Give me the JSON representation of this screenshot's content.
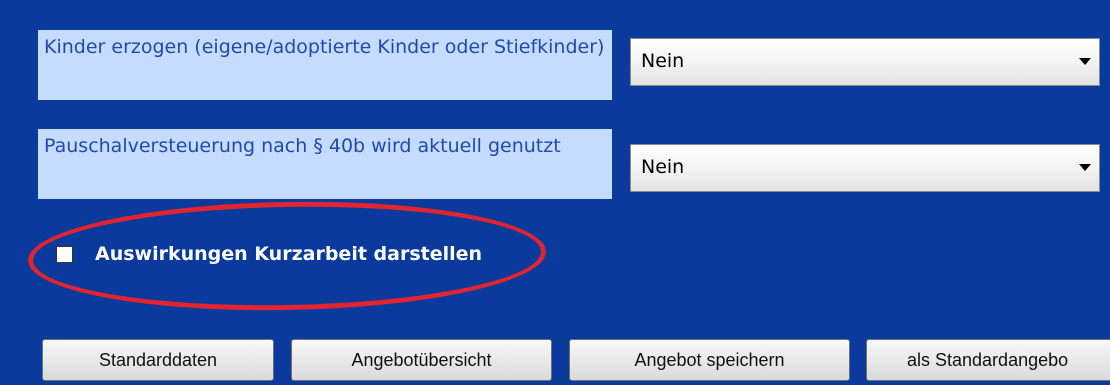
{
  "form": {
    "field_kinder": {
      "label": "Kinder erzogen (eigene/adoptierte Kinder oder Stiefkinder)",
      "value": "Nein"
    },
    "field_pauschal": {
      "label": "Pauschalversteuerung nach § 40b wird aktuell genutzt",
      "value": "Nein"
    },
    "kurzarbeit_checkbox": {
      "label": "Auswirkungen Kurzarbeit darstellen",
      "checked": false
    }
  },
  "annotation": {
    "color": "#e02530"
  },
  "buttons": {
    "standarddaten": "Standarddaten",
    "angebotuebersicht": "Angebotübersicht",
    "angebot_speichern": "Angebot speichern",
    "als_standardangebot": "als Standardangebo"
  },
  "colors": {
    "background": "#0a3a9c",
    "label_background": "#c6dcff",
    "label_text": "#2049b0"
  }
}
